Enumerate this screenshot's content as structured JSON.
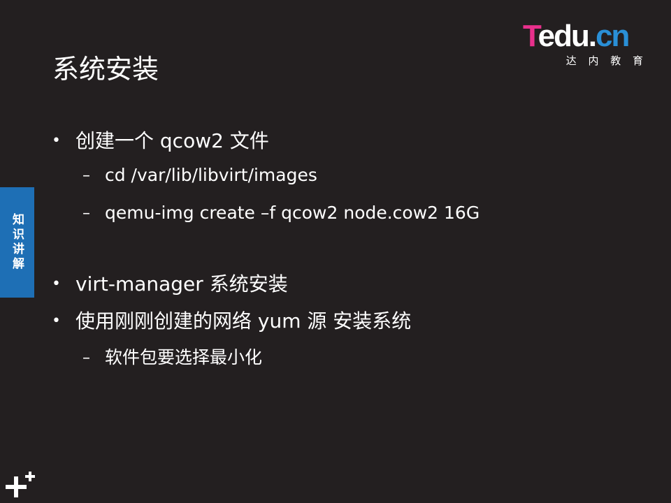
{
  "logo": {
    "brand_t": "T",
    "brand_rest": "edu.",
    "brand_cn": "cn",
    "subtitle": "达 内 教 育"
  },
  "slide": {
    "title": "系统安装",
    "side_tab": "知识讲解",
    "bullets": [
      {
        "level": 1,
        "text": "创建一个 qcow2 文件"
      },
      {
        "level": 2,
        "text": "cd /var/lib/libvirt/images"
      },
      {
        "level": 2,
        "text": "qemu-img create –f qcow2 node.cow2 16G"
      },
      {
        "level": 1,
        "text": "virt-manager 系统安装"
      },
      {
        "level": 1,
        "text": "使用刚刚创建的网络 yum 源 安装系统"
      },
      {
        "level": 2,
        "text": "软件包要选择最小化"
      }
    ],
    "bullet_marker": "•",
    "dash_marker": "–"
  },
  "colors": {
    "background": "#231f20",
    "brand_pink": "#e8308c",
    "brand_blue": "#2a8fd6",
    "side_tab": "#1e6fb5"
  },
  "icons": {
    "corner": "plus-cross-icon"
  }
}
